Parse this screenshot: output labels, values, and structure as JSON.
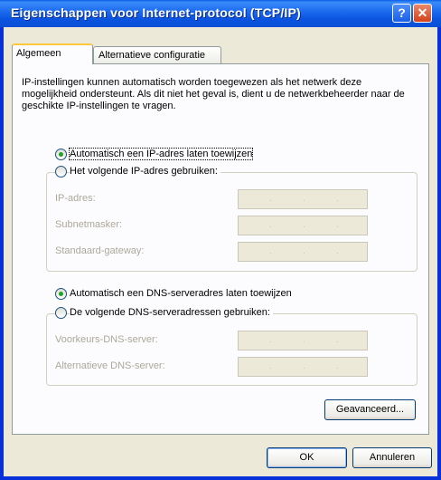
{
  "window": {
    "title": "Eigenschappen voor Internet-protocol (TCP/IP)",
    "help_glyph": "?",
    "close_glyph": "✕"
  },
  "tabs": [
    {
      "label": "Algemeen"
    },
    {
      "label": "Alternatieve configuratie"
    }
  ],
  "description": "IP-instellingen kunnen automatisch worden toegewezen als het netwerk deze mogelijkheid ondersteunt. Als dit niet het geval is, dient u de netwerkbeheerder naar de geschikte IP-instellingen te vragen.",
  "ip": {
    "auto_label": "Automatisch een IP-adres laten toewijzen",
    "manual_label": "Het volgende IP-adres gebruiken:",
    "fields": [
      {
        "label": "IP-adres:"
      },
      {
        "label": "Subnetmasker:"
      },
      {
        "label": "Standaard-gateway:"
      }
    ]
  },
  "dns": {
    "auto_label": "Automatisch een DNS-serveradres laten toewijzen",
    "manual_label": "De volgende DNS-serveradressen gebruiken:",
    "fields": [
      {
        "label": "Voorkeurs-DNS-server:"
      },
      {
        "label": "Alternatieve DNS-server:"
      }
    ]
  },
  "ip_dot": ".",
  "buttons": {
    "advanced": "Geavanceerd...",
    "ok": "OK",
    "cancel": "Annuleren"
  }
}
